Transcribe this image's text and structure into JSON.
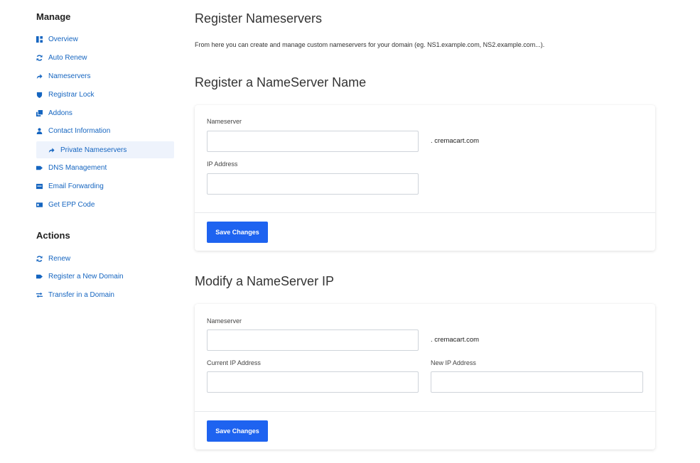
{
  "sidebar": {
    "manage_heading": "Manage",
    "manage_items": [
      {
        "label": "Overview",
        "icon": "overview-icon"
      },
      {
        "label": "Auto Renew",
        "icon": "refresh-icon"
      },
      {
        "label": "Nameservers",
        "icon": "arrow-right-icon"
      },
      {
        "label": "Registrar Lock",
        "icon": "shield-icon"
      },
      {
        "label": "Addons",
        "icon": "addons-icon"
      },
      {
        "label": "Contact Information",
        "icon": "user-icon"
      },
      {
        "label": "Private Nameservers",
        "icon": "arrow-right-icon",
        "active": true
      },
      {
        "label": "DNS Management",
        "icon": "tag-icon"
      },
      {
        "label": "Email Forwarding",
        "icon": "envelope-icon"
      },
      {
        "label": "Get EPP Code",
        "icon": "id-card-icon"
      }
    ],
    "actions_heading": "Actions",
    "action_items": [
      {
        "label": "Renew",
        "icon": "refresh-icon"
      },
      {
        "label": "Register a New Domain",
        "icon": "tag-icon"
      },
      {
        "label": "Transfer in a Domain",
        "icon": "transfer-icon"
      }
    ]
  },
  "main": {
    "title": "Register Nameservers",
    "intro": "From here you can create and manage custom nameservers for your domain (eg. NS1.example.com, NS2.example.com...).",
    "register_section": {
      "title": "Register a NameServer Name",
      "nameserver_label": "Nameserver",
      "nameserver_value": "",
      "domain_suffix": ". cremacart.com",
      "ip_label": "IP Address",
      "ip_value": "",
      "save_label": "Save Changes"
    },
    "modify_section": {
      "title": "Modify a NameServer IP",
      "nameserver_label": "Nameserver",
      "nameserver_value": "",
      "domain_suffix": ". cremacart.com",
      "current_ip_label": "Current IP Address",
      "current_ip_value": "",
      "new_ip_label": "New IP Address",
      "new_ip_value": "",
      "save_label": "Save Changes"
    }
  },
  "colors": {
    "link": "#1565c0",
    "primary_button": "#1e63f0",
    "active_item_bg": "#eef3fc"
  }
}
